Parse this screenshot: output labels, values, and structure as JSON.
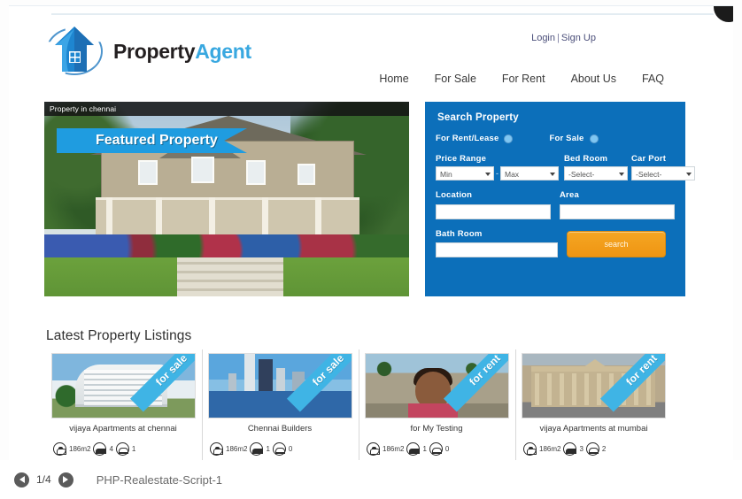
{
  "window": {
    "doc_title": "PHP-Realestate-Script-1",
    "pager": "1/4",
    "prev_icon": "circle-arrow-left-icon",
    "next_icon": "circle-arrow-right-icon"
  },
  "brand": {
    "name_part1": "Property",
    "name_part2": "Agent",
    "logo_icon": "house-logo-icon",
    "accent_color": "#39a8e0",
    "dark_color": "#231f20"
  },
  "header": {
    "login_label": "Login",
    "separator": "|",
    "signup_label": "Sign Up",
    "nav": [
      {
        "label": "Home"
      },
      {
        "label": "For Sale"
      },
      {
        "label": "For Rent"
      },
      {
        "label": "About Us"
      },
      {
        "label": "FAQ"
      }
    ]
  },
  "featured": {
    "caption": "Property in chennai",
    "ribbon": "Featured Property",
    "ribbon_color": "#1f9ce0"
  },
  "search": {
    "title": "Search Property",
    "rent_label": "For Rent/Lease",
    "sale_label": "For Sale",
    "price_label": "Price Range",
    "price_min": "Min",
    "price_max": "Max",
    "dash": "-",
    "bedroom_label": "Bed Room",
    "bedroom_value": "-Select-",
    "carport_label": "Car Port",
    "carport_value": "-Select-",
    "location_label": "Location",
    "location_value": "",
    "location_placeholder": "",
    "area_label": "Area",
    "area_value": "",
    "area_placeholder": "",
    "bathroom_label": "Bath Room",
    "bathroom_value": "",
    "bathroom_placeholder": "",
    "search_button": "search",
    "panel_color": "#0c6fba",
    "button_color": "#f5a623"
  },
  "listings": {
    "title": "Latest Property Listings",
    "cards": [
      {
        "name": "vijaya Apartments at chennai",
        "ribbon": "for sale",
        "area": "186m2",
        "beds": "4",
        "baths": "1",
        "thumb": "apartment-building-photo"
      },
      {
        "name": "Chennai Builders",
        "ribbon": "for sale",
        "area": "186m2",
        "beds": "1",
        "baths": "0",
        "thumb": "city-skyline-photo"
      },
      {
        "name": "for My Testing",
        "ribbon": "for rent",
        "area": "186m2",
        "beds": "1",
        "baths": "0",
        "thumb": "child-portrait-photo"
      },
      {
        "name": "vijaya Apartments at mumbai",
        "ribbon": "for rent",
        "area": "186m2",
        "beds": "3",
        "baths": "2",
        "thumb": "heritage-building-photo"
      }
    ]
  }
}
